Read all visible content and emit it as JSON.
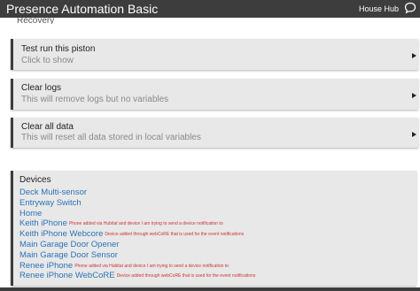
{
  "header": {
    "title": "Presence Automation Basic",
    "hub_name": "House Hub",
    "chat_icon": "chat-icon"
  },
  "partial_heading": "Recovery",
  "actions": [
    {
      "label": "Test run this piston",
      "sub": "Click to show"
    },
    {
      "label": "Clear logs",
      "sub": "This will remove logs but no variables"
    },
    {
      "label": "Clear all data",
      "sub": "This will reset all data stored in local variables"
    }
  ],
  "devices": {
    "title": "Devices",
    "items": [
      {
        "name": "Deck Multi-sensor",
        "note": ""
      },
      {
        "name": "Entryway Switch",
        "note": ""
      },
      {
        "name": "Home",
        "note": ""
      },
      {
        "name": "Keith iPhone",
        "note": "Phone added via Hubitat and device I am trying to send a device notification to"
      },
      {
        "name": "Keith iPhone Webcore",
        "note": "Device added through webCoRE that is used for the event notifications"
      },
      {
        "name": "Main Garage Door Opener",
        "note": ""
      },
      {
        "name": "Main Garage Door Sensor",
        "note": ""
      },
      {
        "name": "Renee iPhone",
        "note": "Phone added via Hubitat and device I am trying to send a device notification to"
      },
      {
        "name": "Renee iPhone WebCoRE",
        "note": "Device added through webCoRE that is used for the event notifications"
      }
    ]
  },
  "colors": {
    "topbar": "#3d3d3d",
    "card_bg": "#e8e8e8",
    "link": "#2a73b8",
    "note": "#cc3333"
  }
}
